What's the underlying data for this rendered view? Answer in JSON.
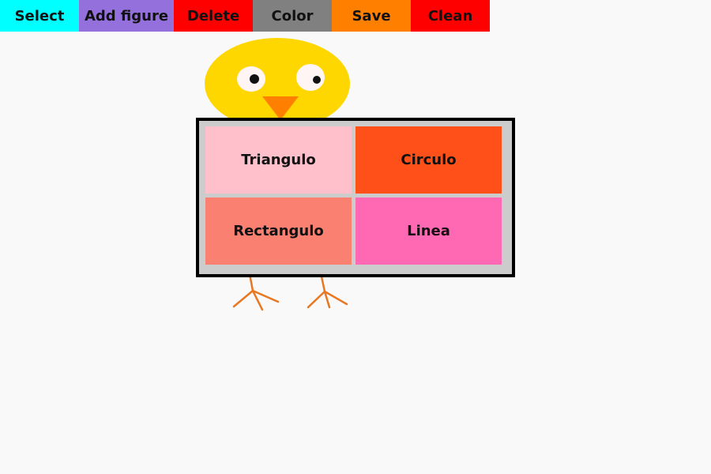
{
  "toolbar": {
    "select_label": "Select",
    "add_figure_label": "Add figure",
    "delete_label": "Delete",
    "color_label": "Color",
    "save_label": "Save",
    "clean_label": "Clean"
  },
  "figure_menu": {
    "items": [
      {
        "label": "Triangulo"
      },
      {
        "label": "Circulo"
      },
      {
        "label": "Rectangulo"
      },
      {
        "label": "Linea"
      }
    ]
  },
  "colors": {
    "select": "#00ffff",
    "add_figure": "#9370db",
    "delete": "#ff0000",
    "color": "#808080",
    "save": "#ff8000",
    "clean": "#ff0000",
    "canvas_background": "#f9f9f9",
    "chick_body": "#ffd700",
    "chick_beak": "#ff7f00",
    "chick_legs": "#e87722",
    "menu_panel": "#cccccc",
    "triangulo": "#ffc0cb",
    "circulo": "#ff5019",
    "rectangulo": "#fa8072",
    "linea": "#ff69b4"
  }
}
